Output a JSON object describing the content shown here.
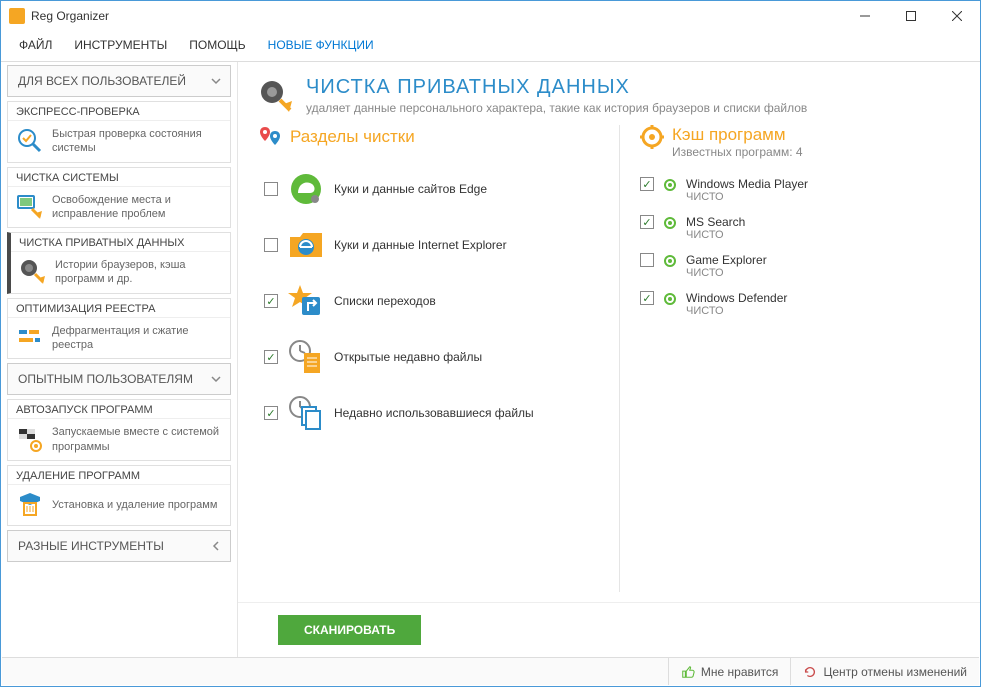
{
  "window": {
    "title": "Reg Organizer"
  },
  "menu": {
    "file": "ФАЙЛ",
    "tools": "ИНСТРУМЕНТЫ",
    "help": "ПОМОЩЬ",
    "new": "НОВЫЕ ФУНКЦИИ"
  },
  "sidebar": {
    "sections": [
      {
        "header": "ДЛЯ ВСЕХ ПОЛЬЗОВАТЕЛЕЙ",
        "expanded": true,
        "items": [
          {
            "head": "ЭКСПРЕСС-ПРОВЕРКА",
            "desc": "Быстрая проверка состояния системы",
            "active": false
          },
          {
            "head": "ЧИСТКА СИСТЕМЫ",
            "desc": "Освобождение места и исправление проблем",
            "active": false
          },
          {
            "head": "ЧИСТКА ПРИВАТНЫХ ДАННЫХ",
            "desc": "Истории браузеров, кэша программ и др.",
            "active": true
          },
          {
            "head": "ОПТИМИЗАЦИЯ РЕЕСТРА",
            "desc": "Дефрагментация и сжатие реестра",
            "active": false
          }
        ]
      },
      {
        "header": "ОПЫТНЫМ ПОЛЬЗОВАТЕЛЯМ",
        "expanded": true,
        "items": [
          {
            "head": "АВТОЗАПУСК ПРОГРАММ",
            "desc": "Запускаемые вместе с системой программы",
            "active": false
          },
          {
            "head": "УДАЛЕНИЕ ПРОГРАММ",
            "desc": "Установка и удаление программ",
            "active": false
          }
        ]
      },
      {
        "header": "РАЗНЫЕ ИНСТРУМЕНТЫ",
        "expanded": false,
        "items": []
      }
    ]
  },
  "page": {
    "title": "ЧИСТКА ПРИВАТНЫХ ДАННЫХ",
    "subtitle": "удаляет данные персонального характера, такие как история браузеров и списки файлов"
  },
  "cleaning": {
    "title": "Разделы чистки",
    "items": [
      {
        "label": "Куки и данные сайтов Edge",
        "checked": false,
        "icon": "edge"
      },
      {
        "label": "Куки и данные Internet Explorer",
        "checked": false,
        "icon": "ie"
      },
      {
        "label": "Списки переходов",
        "checked": true,
        "icon": "jump"
      },
      {
        "label": "Открытые недавно файлы",
        "checked": true,
        "icon": "recent"
      },
      {
        "label": "Недавно использовавшиеся файлы",
        "checked": true,
        "icon": "mru"
      }
    ]
  },
  "cache": {
    "title": "Кэш программ",
    "subtitle": "Известных программ: 4",
    "items": [
      {
        "name": "Windows Media Player",
        "status": "ЧИСТО",
        "checked": true
      },
      {
        "name": "MS Search",
        "status": "ЧИСТО",
        "checked": true
      },
      {
        "name": "Game Explorer",
        "status": "ЧИСТО",
        "checked": false
      },
      {
        "name": "Windows Defender",
        "status": "ЧИСТО",
        "checked": true
      }
    ]
  },
  "buttons": {
    "scan": "СКАНИРОВАТЬ"
  },
  "status": {
    "like": "Мне нравится",
    "undo": "Центр отмены изменений"
  }
}
